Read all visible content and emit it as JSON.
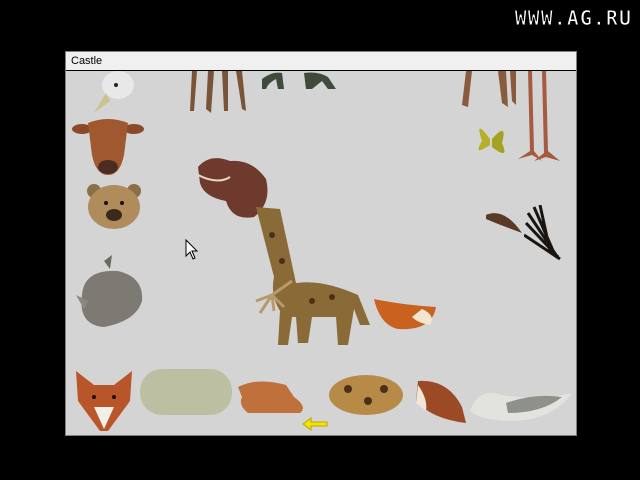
{
  "watermark": "WWW.AG.RU",
  "window": {
    "title": "Castle"
  },
  "palette_parts": [
    {
      "id": "bird-head",
      "icon": "bird-head-icon"
    },
    {
      "id": "cow-head",
      "icon": "cow-head-icon"
    },
    {
      "id": "bear-head",
      "icon": "bear-head-icon"
    },
    {
      "id": "rhino-head",
      "icon": "rhino-head-icon"
    },
    {
      "id": "fox-head",
      "icon": "fox-head-icon"
    },
    {
      "id": "sheep-body",
      "icon": "sheep-body-icon"
    },
    {
      "id": "lion-body",
      "icon": "lion-body-icon"
    },
    {
      "id": "cheetah-body",
      "icon": "cheetah-body-icon"
    },
    {
      "id": "bird-body",
      "icon": "bird-body-icon"
    },
    {
      "id": "gull-body",
      "icon": "gull-body-icon"
    },
    {
      "id": "butterfly-wings",
      "icon": "butterfly-icon"
    },
    {
      "id": "animal-tail",
      "icon": "tail-icon"
    },
    {
      "id": "porcupine-tail",
      "icon": "quill-tail-icon"
    },
    {
      "id": "horse-legs",
      "icon": "legs-icon"
    },
    {
      "id": "dino-legs",
      "icon": "claw-legs-icon"
    },
    {
      "id": "deer-legs",
      "icon": "legs-icon"
    },
    {
      "id": "flamingo-legs",
      "icon": "bird-legs-icon"
    }
  ],
  "creature": {
    "parts": [
      "hippo-head",
      "giraffe-neck-body",
      "bird-claw-leg",
      "fox-tail"
    ]
  },
  "colors": {
    "window_bg": "#d4d4d4",
    "titlebar_bg": "#f0f0f0",
    "pointer_arrow": "#f2e400"
  }
}
